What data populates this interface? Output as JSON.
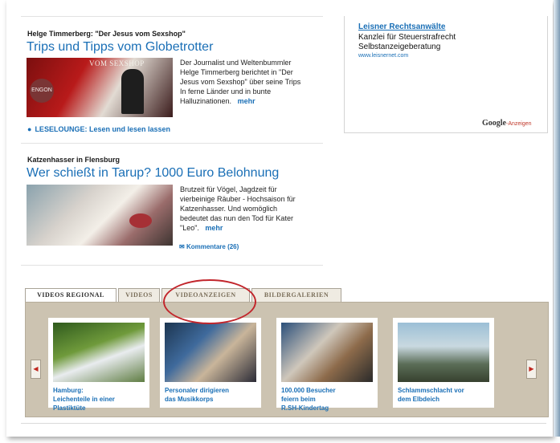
{
  "article1": {
    "kicker": "Helge Timmerberg: \"Der Jesus vom Sexshop\"",
    "headline": "Trips und Tipps vom Globetrotter",
    "image_stamp": "VOM SEXSHOP",
    "image_logo": "ENGON",
    "teaser_lines": [
      "Der Journalist und Weltenbummler",
      "Helge Timmerberg berichtet in \"Der",
      "Jesus vom Sexshop\" über seine Trips",
      "In ferne Länder und in bunte",
      "Halluzinationen."
    ],
    "more": "mehr",
    "link": "LESELOUNGE: Lesen und lesen lassen"
  },
  "article2": {
    "kicker": "Katzenhasser in Flensburg",
    "headline": "Wer schießt in Tarup? 1000 Euro Belohnung",
    "teaser_lines": [
      "Brutzeit für Vögel, Jagdzeit für",
      "vierbeinige Räuber - Hochsaison für",
      "Katzenhasser. Und womöglich",
      "bedeutet das nun den Tod für Kater",
      "\"Leo\"."
    ],
    "more": "mehr",
    "comments": "Kommentare (26)"
  },
  "ad": {
    "title": "Leisner Rechtsanwälte",
    "line1": "Kanzlei für Steuerstrafrecht",
    "line2": "Selbstanzeigeberatung",
    "url": "www.leisnernet.com",
    "google": "Google",
    "anzeigen": "-Anzeigen"
  },
  "tabs": [
    "VIDEOS REGIONAL",
    "VIDEOS",
    "VIDEOANZEIGEN",
    "BILDERGALERIEN"
  ],
  "videos": [
    {
      "caption": [
        "Hamburg:",
        "Leichenteile in einer",
        "Plastiktüte"
      ]
    },
    {
      "caption": [
        "Personaler dirigieren",
        "das Musikkorps"
      ]
    },
    {
      "caption": [
        "100.000 Besucher",
        "feiern beim",
        "R.SH-Kindertag"
      ]
    },
    {
      "caption": [
        "Schlammschlacht vor",
        "dem Elbdeich"
      ]
    }
  ],
  "colors": {
    "link": "#1a6fb6",
    "panel": "#ccc3b1",
    "highlight": "#c2262c"
  }
}
